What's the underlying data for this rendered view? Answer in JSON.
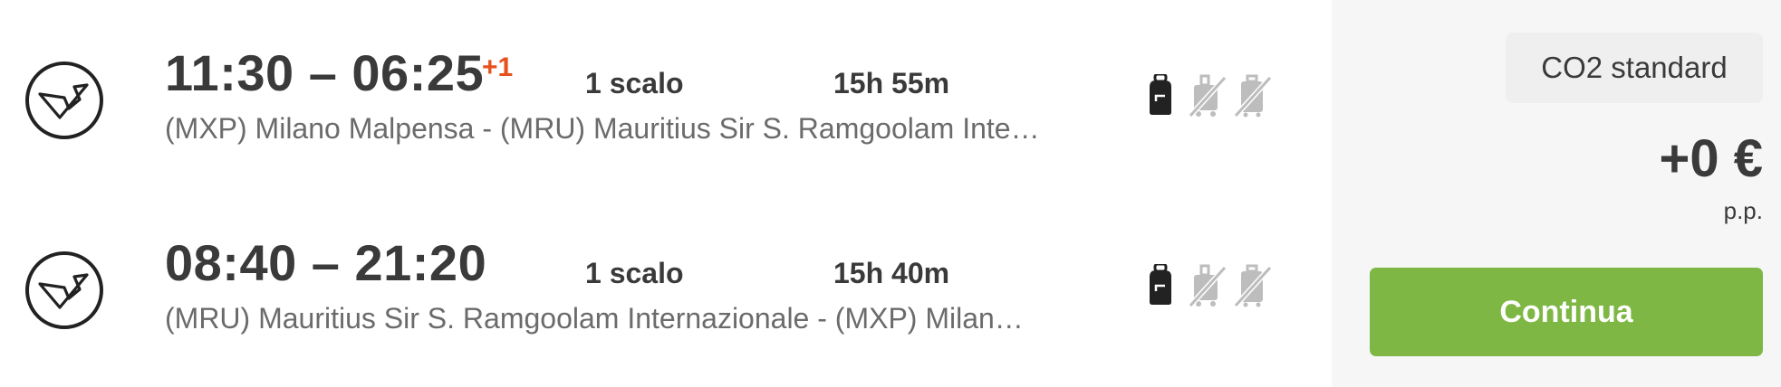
{
  "legs": [
    {
      "airline_icon": "condor-logo-icon",
      "times": "11:30 – 06:25",
      "day_offset": "+1",
      "stops": "1 scalo",
      "duration": "15h 55m",
      "route": "(MXP) Milano Malpensa - (MRU) Mauritius Sir S. Ramgoolam Inte…",
      "baggage": [
        "backpack-icon",
        "cabin-bag-not-included-icon",
        "checked-bag-not-included-icon"
      ]
    },
    {
      "airline_icon": "condor-logo-icon",
      "times": "08:40 – 21:20",
      "day_offset": "",
      "stops": "1 scalo",
      "duration": "15h 40m",
      "route": "(MRU) Mauritius Sir S. Ramgoolam Internazionale - (MXP) Milan…",
      "baggage": [
        "backpack-icon",
        "cabin-bag-not-included-icon",
        "checked-bag-not-included-icon"
      ]
    }
  ],
  "sidebar": {
    "co2_label": "CO2 standard",
    "price": "+0 €",
    "price_unit": "p.p.",
    "continue_label": "Continua"
  },
  "colors": {
    "accent_green": "#7eb744",
    "day_offset_red": "#e8501c",
    "text_dark": "#3a3a3a",
    "text_muted": "#6b6b6b",
    "icon_disabled": "#bdbdbd"
  }
}
